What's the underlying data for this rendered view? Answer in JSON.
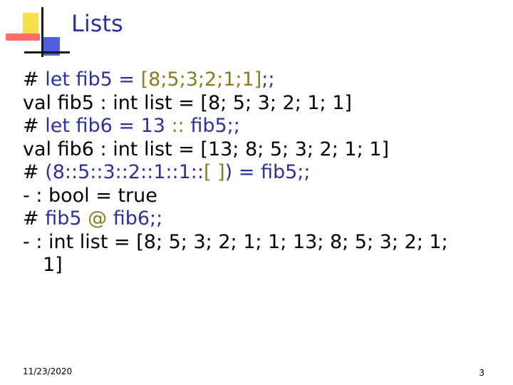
{
  "slide": {
    "title": "Lists",
    "lines": [
      {
        "id": "l1",
        "parts": [
          {
            "text": "# ",
            "style": "plain"
          },
          {
            "text": "let fib5 = ",
            "style": "kw"
          },
          {
            "text": "[8;5;3;2;1;1]",
            "style": "hl"
          },
          {
            "text": ";;",
            "style": "kw"
          }
        ]
      },
      {
        "id": "l2",
        "parts": [
          {
            "text": "val fib5 : int list = [8; 5; 3; 2; 1; 1]",
            "style": "plain"
          }
        ]
      },
      {
        "id": "l3",
        "parts": [
          {
            "text": "# ",
            "style": "plain"
          },
          {
            "text": "let fib6 = 13 ",
            "style": "kw"
          },
          {
            "text": "::",
            "style": "hl"
          },
          {
            "text": " fib5;;",
            "style": "kw"
          }
        ]
      },
      {
        "id": "l4",
        "parts": [
          {
            "text": "val fib6 : int list = [13; 8; 5; 3; 2; 1; 1]",
            "style": "plain"
          }
        ]
      },
      {
        "id": "l5",
        "parts": [
          {
            "text": "# ",
            "style": "plain"
          },
          {
            "text": "(8::5::3::2::1::1::",
            "style": "kw"
          },
          {
            "text": "[ ]",
            "style": "hl"
          },
          {
            "text": ") = fib5;;",
            "style": "kw"
          }
        ]
      },
      {
        "id": "l6",
        "parts": [
          {
            "text": "- : bool = true",
            "style": "plain"
          }
        ]
      },
      {
        "id": "l7",
        "parts": [
          {
            "text": "# ",
            "style": "plain"
          },
          {
            "text": "fib5 ",
            "style": "kw"
          },
          {
            "text": "@",
            "style": "hl"
          },
          {
            "text": " fib6;;",
            "style": "kw"
          }
        ]
      },
      {
        "id": "l8",
        "parts": [
          {
            "text": "- : int list = [8; 5; 3; 2; 1; 1; 13; 8; 5; 3; 2; 1;",
            "style": "plain"
          }
        ]
      },
      {
        "id": "l9",
        "indent": true,
        "parts": [
          {
            "text": "1]",
            "style": "plain"
          }
        ]
      }
    ]
  },
  "footer": {
    "date": "11/23/2020",
    "page": "3"
  },
  "colors": {
    "title": "#2b3299",
    "keyword": "#2b3299",
    "highlight": "#8a7a1e",
    "text": "#000000"
  }
}
